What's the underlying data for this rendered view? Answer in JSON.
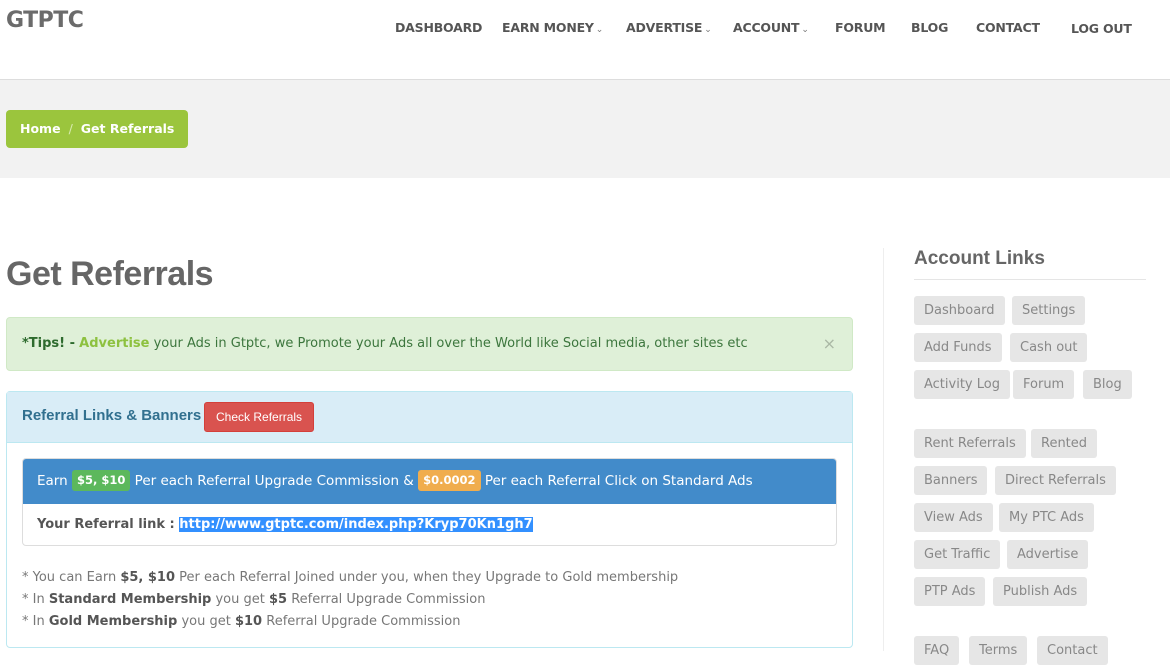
{
  "brand": "GTPTC",
  "nav": {
    "items": [
      {
        "label": "DASHBOARD",
        "dropdown": false
      },
      {
        "label": "EARN MONEY",
        "dropdown": true
      },
      {
        "label": "ADVERTISE",
        "dropdown": true
      },
      {
        "label": "ACCOUNT",
        "dropdown": true
      },
      {
        "label": "FORUM",
        "dropdown": false
      },
      {
        "label": "BLOG",
        "dropdown": false
      },
      {
        "label": "CONTACT",
        "dropdown": false
      },
      {
        "label": "LOG OUT",
        "dropdown": false
      }
    ],
    "chevron": "⌄"
  },
  "breadcrumb": {
    "home": "Home",
    "separator": "/",
    "current": "Get Referrals"
  },
  "page_title": "Get Referrals",
  "alert": {
    "prefix": "*Tips! -",
    "highlight": "Advertise",
    "text": "your Ads in Gtptc, we Promote your Ads all over the World like Social media, other sites etc",
    "close": "×"
  },
  "panel": {
    "title": "Referral Links & Banners",
    "check_button": "Check Referrals",
    "earn": {
      "pre": "Earn",
      "upgrade_badge": "$5, $10",
      "mid": "Per each Referral Upgrade Commission &",
      "click_badge": "$0.0002",
      "post": "Per each Referral Click on Standard Ads"
    },
    "referral_label": "Your Referral link :",
    "referral_link": "http://www.gtptc.com/index.php?Kryp70Kn1gh7",
    "notes": [
      {
        "a": "* You can Earn ",
        "b": "$5, $10",
        "c": " Per each Referral Joined under you, when they Upgrade to Gold membership",
        "d": "",
        "e": ""
      },
      {
        "a": "* In ",
        "b": "Standard Membership",
        "c": " you get ",
        "d": "$5",
        "e": " Referral Upgrade Commission"
      },
      {
        "a": "* In ",
        "b": "Gold Membership",
        "c": " you get ",
        "d": "$10",
        "e": " Referral Upgrade Commission"
      }
    ]
  },
  "sidebar": {
    "title": "Account Links",
    "links": [
      "Dashboard",
      "Settings",
      "Add Funds",
      "Cash out",
      "Activity Log",
      "Forum",
      "Blog",
      "Rent Referrals",
      "Rented",
      "Banners",
      "Direct Referrals",
      "View Ads",
      "My PTC Ads",
      "Get Traffic",
      "Advertise",
      "PTP Ads",
      "Publish Ads",
      "FAQ",
      "Terms",
      "Contact"
    ]
  },
  "colors": {
    "brand_green": "#9bc53d",
    "primary_blue": "#428bca",
    "danger_red": "#d9534f",
    "warning_orange": "#f0ad4e",
    "success_green": "#5cb85c"
  }
}
